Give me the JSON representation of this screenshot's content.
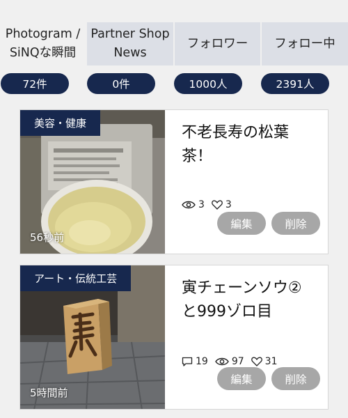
{
  "tabs": [
    {
      "line1": "Photogram /",
      "line2": "SiNQな瞬間"
    },
    {
      "line1": "Partner Shop",
      "line2": "News"
    },
    {
      "line1": "フォロワー",
      "line2": ""
    },
    {
      "line1": "フォロー中",
      "line2": ""
    }
  ],
  "counts": [
    "72件",
    "0件",
    "1000人",
    "2391人"
  ],
  "posts": [
    {
      "category": "美容・健康",
      "time": "56秒前",
      "title": "不老長寿の松葉茶！",
      "views": "3",
      "likes": "3",
      "edit_label": "編集",
      "delete_label": "削除"
    },
    {
      "category": "アート・伝統工芸",
      "time": "5時間前",
      "title": "寅チェーンソウ②と999ゾロ目",
      "comments": "19",
      "views": "97",
      "likes": "31",
      "edit_label": "編集",
      "delete_label": "削除"
    }
  ],
  "colors": {
    "navy": "#17284e",
    "tab_inactive": "#dcdfe6",
    "button_gray": "#a7a7a7",
    "background": "#f0f0f0"
  }
}
